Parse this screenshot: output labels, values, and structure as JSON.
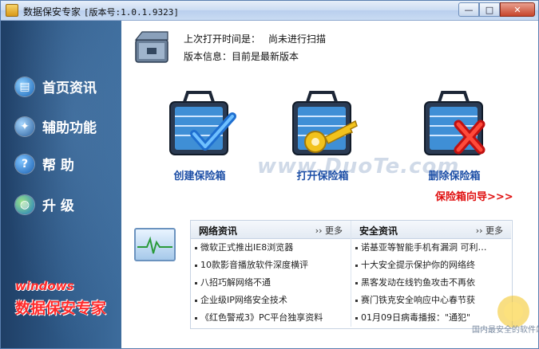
{
  "window": {
    "title": "数据保安专家",
    "version": "[版本号:1.0.1.9323]"
  },
  "controls": {
    "minimize": "—",
    "maximize": "□",
    "close": "✕"
  },
  "info": {
    "last_open_label": "上次打开时间是：",
    "last_open_value": "尚未进行扫描",
    "version_label": "版本信息：",
    "version_value": "目前是最新版本"
  },
  "sidebar": {
    "items": [
      {
        "label": "首页资讯",
        "icon": "doc-globe-icon"
      },
      {
        "label": "辅助功能",
        "icon": "satellite-icon"
      },
      {
        "label": "帮  助",
        "icon": "help-icon"
      },
      {
        "label": "升  级",
        "icon": "globe-icon"
      }
    ],
    "brand_line1": "windows",
    "brand_line2": "数据保安专家"
  },
  "actions": [
    {
      "label": "创建保险箱",
      "icon": "create-safe-icon"
    },
    {
      "label": "打开保险箱",
      "icon": "open-safe-icon"
    },
    {
      "label": "删除保险箱",
      "icon": "delete-safe-icon"
    }
  ],
  "wizard_link": "保险箱向导>>>",
  "watermark": "www.DuoTe.com",
  "news": {
    "network": {
      "title": "网络资讯",
      "more": "›› 更多",
      "items": [
        "微软正式推出IE8浏览器",
        "10款影音播放软件深度横评",
        "八招巧解网络不通",
        "企业级IP网络安全技术",
        "《红色警戒3》PC平台独享资料"
      ]
    },
    "security": {
      "title": "安全资讯",
      "more": "›› 更多",
      "items": [
        "诺基亚等智能手机有漏洞 可利…",
        "十大安全提示保护你的网络终",
        "黑客发动在线钓鱼攻击不再依",
        "赛门铁克安全响应中心春节获",
        "01月09日病毒播报：\"通犯\""
      ]
    }
  },
  "corner": {
    "text": "国内最安全的软件站"
  },
  "colors": {
    "accent_blue": "#1c4ea6",
    "wizard_red": "#e01010",
    "sidebar_bg": "#2f5a88"
  }
}
